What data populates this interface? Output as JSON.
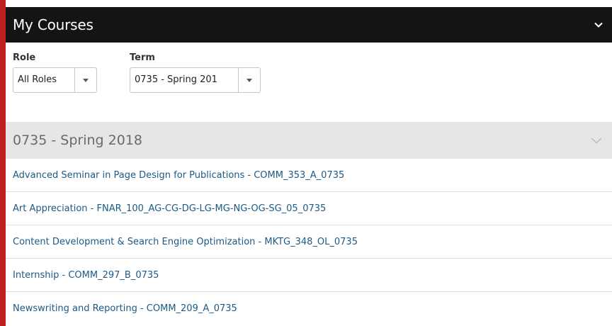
{
  "widget": {
    "title": "My Courses",
    "collapse_icon": "chevron-down-icon"
  },
  "filters": {
    "role": {
      "label": "Role",
      "value": "All Roles"
    },
    "term": {
      "label": "Term",
      "value": "0735 - Spring 201"
    }
  },
  "term_group": {
    "title": "0735 - Spring 2018",
    "expand_icon": "chevron-down-icon",
    "courses": [
      "Advanced Seminar in Page Design for Publications - COMM_353_A_0735",
      "Art Appreciation - FNAR_100_AG-CG-DG-LG-MG-NG-OG-SG_05_0735",
      "Content Development & Search Engine Optimization - MKTG_348_OL_0735",
      "Internship - COMM_297_B_0735",
      "Newswriting and Reporting - COMM_209_A_0735"
    ]
  },
  "colors": {
    "accent_red": "#c21f1f",
    "header_bg": "#141414",
    "term_bg": "#e6e6e6",
    "link": "#1c5a86"
  }
}
